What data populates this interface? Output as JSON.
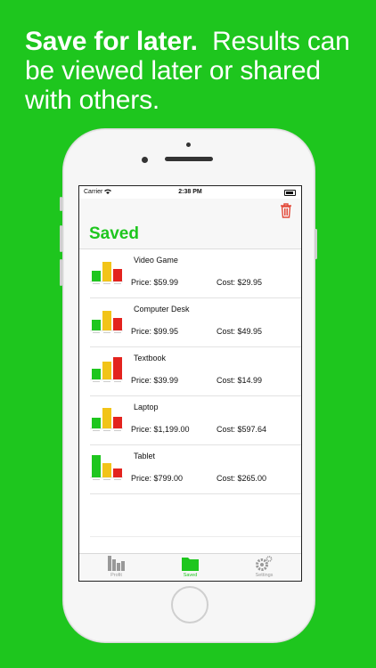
{
  "headline": {
    "bold": "Save for later.",
    "rest": "Results can be viewed later or shared with others."
  },
  "status_bar": {
    "carrier": "Carrier",
    "time": "2:38 PM"
  },
  "nav": {
    "title": "Saved"
  },
  "colors": {
    "brand_green": "#1ec61e",
    "yellow": "#f2c418",
    "red": "#e3231e",
    "trash_red": "#e34a3a"
  },
  "items": [
    {
      "name": "Video Game",
      "price": "Price: $59.99",
      "cost": "Cost: $29.95",
      "bars": [
        0.45,
        0.85,
        0.55
      ]
    },
    {
      "name": "Computer Desk",
      "price": "Price: $99.95",
      "cost": "Cost: $49.95",
      "bars": [
        0.45,
        0.85,
        0.55
      ]
    },
    {
      "name": "Textbook",
      "price": "Price: $39.99",
      "cost": "Cost: $14.99",
      "bars": [
        0.45,
        0.75,
        0.95
      ]
    },
    {
      "name": "Laptop",
      "price": "Price: $1,199.00",
      "cost": "Cost: $597.64",
      "bars": [
        0.45,
        0.9,
        0.5
      ]
    },
    {
      "name": "Tablet",
      "price": "Price: $799.00",
      "cost": "Cost: $265.00",
      "bars": [
        0.95,
        0.6,
        0.4
      ]
    }
  ],
  "tabs": [
    {
      "label": "Profit",
      "icon": "bar-chart-icon",
      "active": false
    },
    {
      "label": "Saved",
      "icon": "folder-icon",
      "active": true
    },
    {
      "label": "Settings",
      "icon": "gear-icon",
      "active": false
    }
  ]
}
